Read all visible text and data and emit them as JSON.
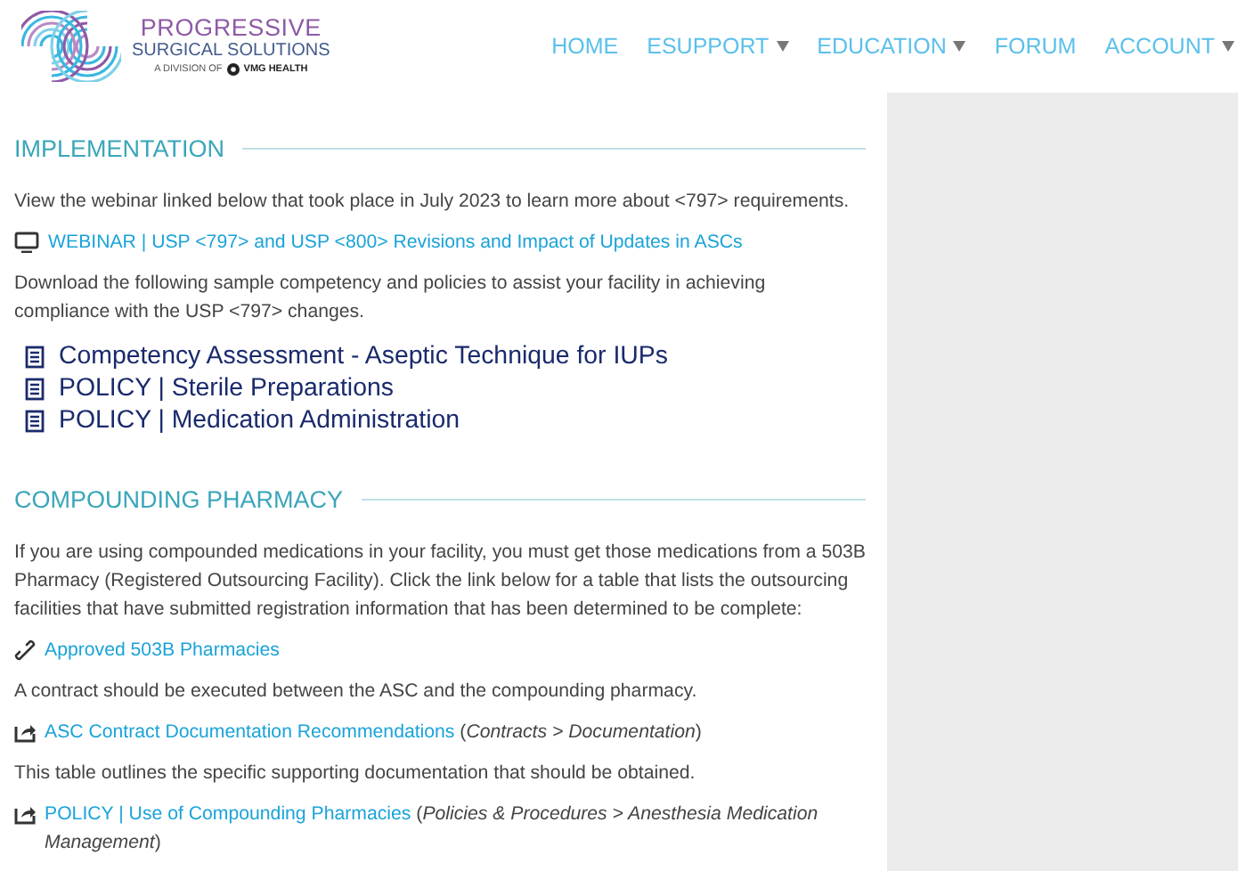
{
  "header": {
    "logo": {
      "title": "PROGRESSIVE",
      "subtitle": "SURGICAL SOLUTIONS",
      "division": "A DIVISION OF",
      "partner": "VMG HEALTH"
    },
    "nav": [
      {
        "label": "HOME",
        "dropdown": false
      },
      {
        "label": "ESUPPORT",
        "dropdown": true
      },
      {
        "label": "EDUCATION",
        "dropdown": true
      },
      {
        "label": "FORUM",
        "dropdown": false
      },
      {
        "label": "ACCOUNT",
        "dropdown": true
      }
    ]
  },
  "sections": [
    {
      "title": "IMPLEMENTATION",
      "blocks": [
        {
          "kind": "text",
          "text": "View the webinar linked below that took place in July 2023 to learn more about <797> requirements."
        },
        {
          "kind": "webinar",
          "label": "WEBINAR | USP <797> and USP <800> Revisions and Impact of Updates in ASCs"
        },
        {
          "kind": "text",
          "text": "Download the following sample competency and policies to assist your facility in achieving compliance with the USP <797> changes."
        },
        {
          "kind": "doc",
          "label": "Competency Assessment - Aseptic Technique for IUPs"
        },
        {
          "kind": "doc",
          "label": "POLICY | Sterile Preparations"
        },
        {
          "kind": "doc",
          "label": "POLICY | Medication Administration"
        }
      ]
    },
    {
      "title": "COMPOUNDING PHARMACY",
      "blocks": [
        {
          "kind": "text",
          "text": "If you are using compounded medications in your facility, you must get those medications from a 503B Pharmacy (Registered Outsourcing Facility). Click the link below for a table that lists the outsourcing facilities that have submitted registration information that has been determined to be complete:"
        },
        {
          "kind": "weblink",
          "label": "Approved 503B Pharmacies"
        },
        {
          "kind": "text",
          "text": "A contract should be executed between the ASC and the compounding pharmacy."
        },
        {
          "kind": "external",
          "label": "ASC Contract Documentation Recommendations",
          "note": "(*Contracts > Documentation*)"
        },
        {
          "kind": "text",
          "text": "This table outlines the specific supporting documentation that should be obtained."
        },
        {
          "kind": "external",
          "label": "POLICY | Use of Compounding Pharmacies",
          "note": "(*Policies & Procedures > Anesthesia Medication Management*)"
        }
      ]
    }
  ]
}
